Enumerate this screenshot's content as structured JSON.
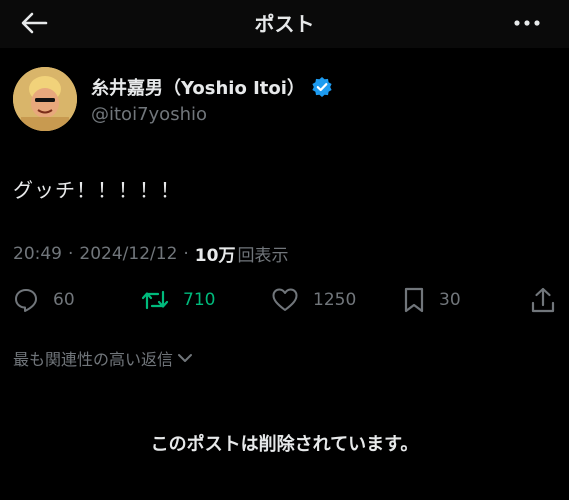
{
  "header": {
    "title": "ポスト"
  },
  "tweet": {
    "display_name": "糸井嘉男（Yoshio Itoi）",
    "handle": "@itoi7yoshio",
    "text": "グッチ！！！！！",
    "time": "20:49",
    "separator": "·",
    "date": "2024/12/12",
    "views_count": "10万",
    "views_label": "回表示"
  },
  "actions": {
    "replies": "60",
    "retweets": "710",
    "likes": "1250",
    "bookmarks": "30"
  },
  "replies_section": {
    "sort_label": "最も関連性の高い返信"
  },
  "deleted_notice": "このポストは削除されています。",
  "colors": {
    "background": "#000000",
    "retweet_green": "#00ba7c",
    "verified_blue": "#1d9bf0",
    "muted": "#71767b"
  }
}
